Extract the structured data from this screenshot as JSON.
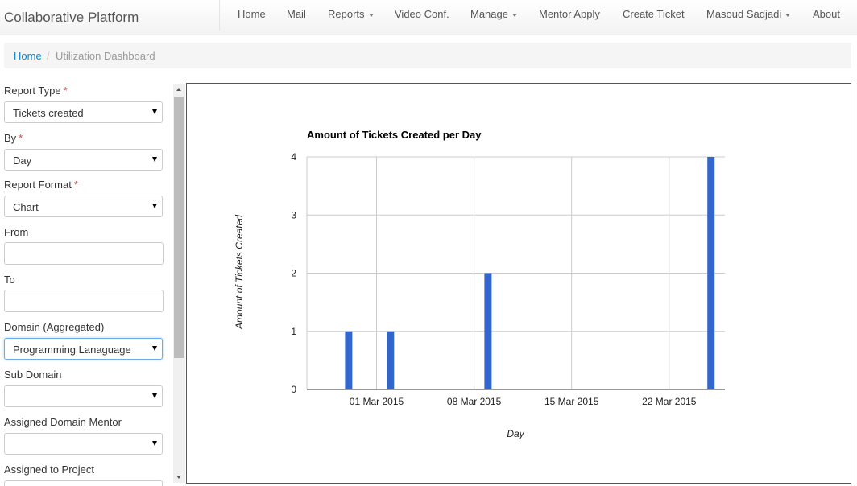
{
  "navbar": {
    "brand": "Collaborative Platform",
    "items": [
      {
        "label": "Home",
        "dropdown": false
      },
      {
        "label": "Mail",
        "dropdown": false
      },
      {
        "label": "Reports",
        "dropdown": true
      },
      {
        "label": "Video Conf.",
        "dropdown": false
      },
      {
        "label": "Manage",
        "dropdown": true
      },
      {
        "label": "Mentor Apply",
        "dropdown": false
      },
      {
        "label": "Create Ticket",
        "dropdown": false
      },
      {
        "label": "Masoud Sadjadi",
        "dropdown": true
      },
      {
        "label": "About",
        "dropdown": false
      }
    ]
  },
  "breadcrumb": {
    "home": "Home",
    "separator": "/",
    "current": "Utilization Dashboard"
  },
  "form": {
    "report_type": {
      "label": "Report Type",
      "required_mark": "*",
      "value": "Tickets created"
    },
    "by": {
      "label": "By",
      "required_mark": "*",
      "value": "Day"
    },
    "report_format": {
      "label": "Report Format",
      "required_mark": "*",
      "value": "Chart"
    },
    "from": {
      "label": "From",
      "value": ""
    },
    "to": {
      "label": "To",
      "value": ""
    },
    "domain": {
      "label": "Domain (Aggregated)",
      "value": "Programming Lanaguage"
    },
    "sub_domain": {
      "label": "Sub Domain",
      "value": ""
    },
    "assigned_mentor": {
      "label": "Assigned Domain Mentor",
      "value": ""
    },
    "assigned_project": {
      "label": "Assigned to Project"
    }
  },
  "chart_data": {
    "type": "bar",
    "title": "Amount of Tickets Created per Day",
    "xlabel": "Day",
    "ylabel": "Amount of Tickets Created",
    "x_ticks": [
      "01 Mar 2015",
      "08 Mar 2015",
      "15 Mar 2015",
      "22 Mar 2015"
    ],
    "x_range": [
      "2015-02-24",
      "2015-03-26"
    ],
    "ylim": [
      0,
      4
    ],
    "y_ticks": [
      0,
      1,
      2,
      3,
      4
    ],
    "grid": true,
    "bar_color": "#3366cc",
    "points": [
      {
        "x": "2015-02-27",
        "y": 1
      },
      {
        "x": "2015-03-02",
        "y": 1
      },
      {
        "x": "2015-03-09",
        "y": 2
      },
      {
        "x": "2015-03-25",
        "y": 4
      }
    ]
  }
}
